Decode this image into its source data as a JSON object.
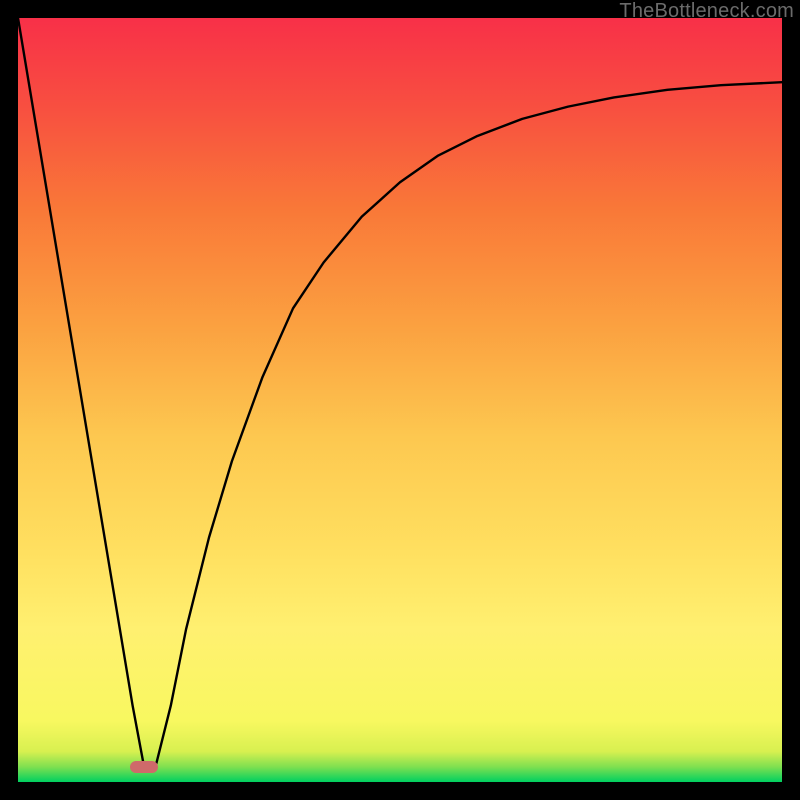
{
  "watermark": {
    "text": "TheBottleneck.com"
  },
  "chart_data": {
    "type": "line",
    "title": "",
    "xlabel": "",
    "ylabel": "",
    "xlim": [
      0,
      100
    ],
    "ylim": [
      0,
      100
    ],
    "grid": false,
    "series": [
      {
        "name": "bottleneck-curve",
        "x": [
          0,
          4,
          8,
          12,
          15,
          16.5,
          18,
          20,
          22,
          25,
          28,
          32,
          36,
          40,
          45,
          50,
          55,
          60,
          66,
          72,
          78,
          85,
          92,
          100
        ],
        "y": [
          100,
          76,
          52,
          28,
          10,
          2,
          2,
          10,
          20,
          32,
          42,
          53,
          62,
          68,
          74,
          78.5,
          82,
          84.5,
          86.8,
          88.4,
          89.6,
          90.6,
          91.2,
          91.6
        ]
      }
    ],
    "markers": [
      {
        "name": "minimum-pill",
        "x": 16.5,
        "y": 2,
        "color": "#cf6a6a"
      }
    ],
    "gradient_stops": [
      {
        "pos": 0,
        "color": "#00d060"
      },
      {
        "pos": 2,
        "color": "#80e050"
      },
      {
        "pos": 4,
        "color": "#d8f050"
      },
      {
        "pos": 8,
        "color": "#f8f860"
      },
      {
        "pos": 20,
        "color": "#fff070"
      },
      {
        "pos": 30,
        "color": "#ffe060"
      },
      {
        "pos": 45,
        "color": "#fdc850"
      },
      {
        "pos": 60,
        "color": "#fba040"
      },
      {
        "pos": 75,
        "color": "#f97838"
      },
      {
        "pos": 88,
        "color": "#f85040"
      },
      {
        "pos": 100,
        "color": "#f83048"
      }
    ]
  }
}
